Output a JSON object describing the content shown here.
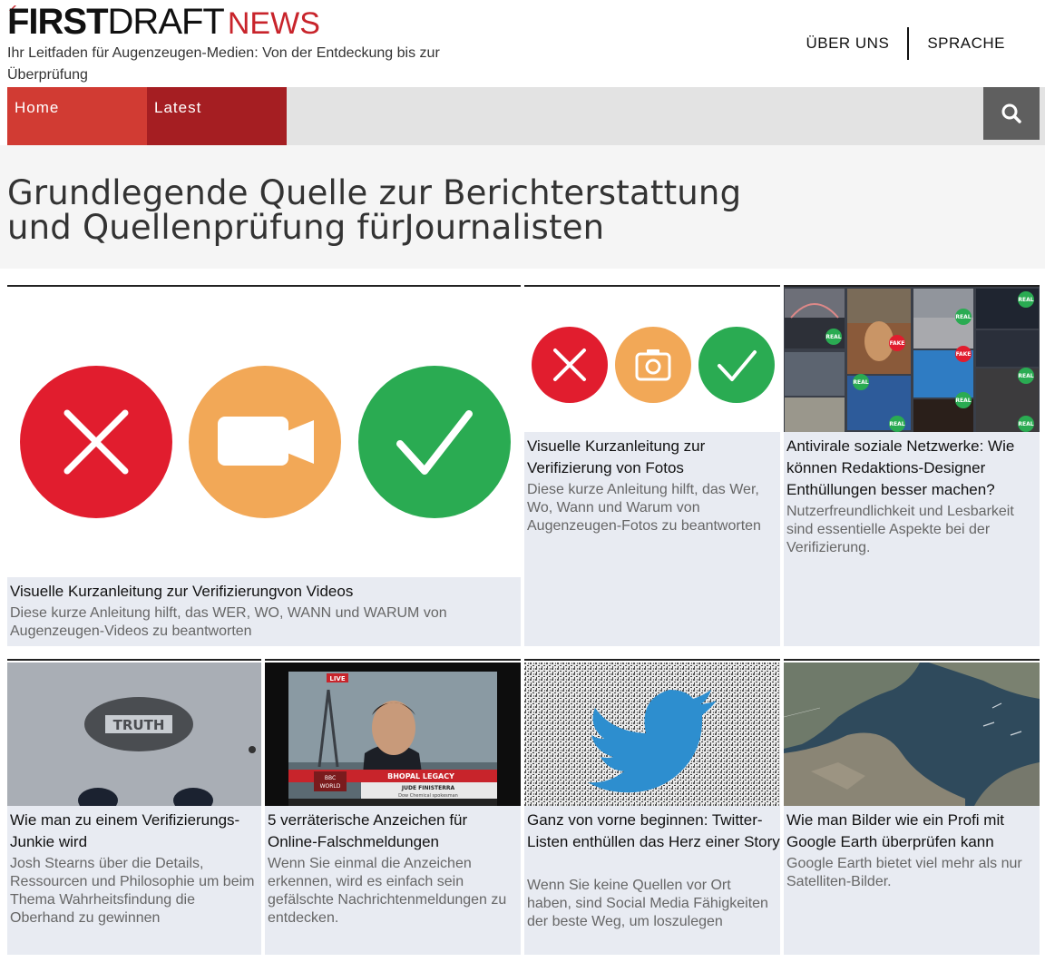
{
  "header": {
    "logo_first": "FIRST",
    "logo_draft": "DRAFT",
    "logo_news": "NEWS",
    "tagline": "Ihr Leitfaden für Augenzeugen-Medien: Von der Entdeckung bis zur Überprüfung",
    "nav_about": "ÜBER UNS",
    "nav_language": "SPRACHE"
  },
  "navbar": {
    "home": "Home",
    "latest": "Latest",
    "search_icon": "search-icon"
  },
  "page": {
    "title_line1": "Grundlegende Quelle zur Berichterstattung",
    "title_line2": "und Quellenprüfung fürJournalisten"
  },
  "cards": [
    {
      "title": "Visuelle Kurzanleitung zur Verifizierungvon Videos",
      "desc": "Diese kurze Anleitung hilft, das WER, WO, WANN und WARUM von Augenzeugen-Videos zu beantworten"
    },
    {
      "title": "Visuelle Kurzanleitung zur Verifizierung von Fotos",
      "desc": "Diese kurze Anleitung hilft, das Wer, Wo, Wann und Warum von Augenzeugen-Fotos zu beantworten"
    },
    {
      "title": "Antivirale soziale Netzwerke: Wie können Redaktions-Designer Enthüllungen besser machen?",
      "desc": "Nutzerfreundlichkeit und Lesbarkeit sind essentielle Aspekte bei der Verifizierung."
    },
    {
      "title": "Wie man zu einem Verifizierungs-Junkie wird",
      "desc": "Josh Stearns über die Details, Ressourcen und Philosophie um beim Thema Wahrheitsfindung die Oberhand zu gewinnen",
      "image_text": "TRUTH"
    },
    {
      "title": "5 verräterische Anzeichen für Online-Falschmeldungen",
      "desc": "Wenn Sie einmal die Anzeichen erkennen, wird es einfach sein gefälschte Nachrichtenmeldungen zu entdecken.",
      "image_text": {
        "live": "LIVE",
        "headline": "BHOPAL LEGACY",
        "name": "JUDE FINISTERRA",
        "role": "Dow Chemical spokesman",
        "channel_top": "BBC",
        "channel_bottom": "WORLD"
      }
    },
    {
      "title": "Ganz von vorne beginnen: Twitter-Listen enthüllen das Herz einer Story",
      "desc": "Wenn Sie keine Quellen vor Ort haben, sind Social Media Fähigkeiten der beste Weg, um loszulegen"
    },
    {
      "title": "Wie man Bilder wie ein Profi mit Google Earth überprüfen kann",
      "desc": "Google Earth bietet viel mehr als nur Satelliten-Bilder."
    }
  ],
  "collage_tags": [
    "REAL",
    "REAL",
    "FAKE",
    "REAL",
    "FAKE",
    "REAL",
    "REAL",
    "REAL",
    "REAL",
    "REAL"
  ],
  "colors": {
    "brand_red": "#c8242b",
    "home_red": "#d13b33",
    "latest_red": "#a51e22",
    "reject_red": "#e11d2e",
    "media_orange": "#f2a857",
    "verify_green": "#2aab52",
    "card_bg": "#e8ebf2"
  }
}
